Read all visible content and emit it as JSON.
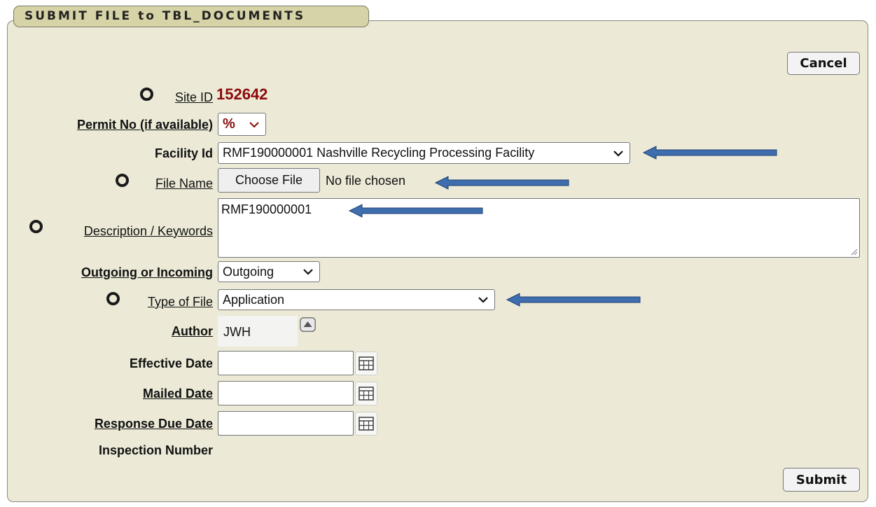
{
  "form": {
    "title": "SUBMIT FILE to TBL_DOCUMENTS",
    "cancel_label": "Cancel",
    "submit_label": "Submit"
  },
  "fields": {
    "site_id_label": "Site ID",
    "site_id_value": "152642",
    "permit_label": "Permit No (if available)",
    "permit_value": "%",
    "facility_label": "Facility Id",
    "facility_value": "RMF190000001 Nashville Recycling Processing Facility",
    "file_name_label": "File Name",
    "choose_file_label": "Choose File",
    "no_file_text": "No file chosen",
    "description_label": "Description / Keywords",
    "description_value": "RMF190000001",
    "direction_label": "Outgoing or Incoming",
    "direction_value": "Outgoing",
    "type_label": "Type of File",
    "type_value": "Application",
    "author_label": "Author",
    "author_value": "JWH",
    "effective_date_label": "Effective Date",
    "mailed_date_label": "Mailed Date",
    "response_due_label": "Response Due Date",
    "inspection_label": "Inspection Number"
  },
  "icons": {
    "required": "required-circle-icon",
    "calendar": "calendar-icon",
    "author_picker": "caret-up-icon",
    "dropdown": "chevron-down-icon",
    "annotation": "annotation-arrow-icon"
  },
  "colors": {
    "panel_bg": "#ecead7",
    "title_tab_bg": "#d6d3a7",
    "site_id": "#8b0a0a",
    "arrow": "#3f6eae"
  }
}
